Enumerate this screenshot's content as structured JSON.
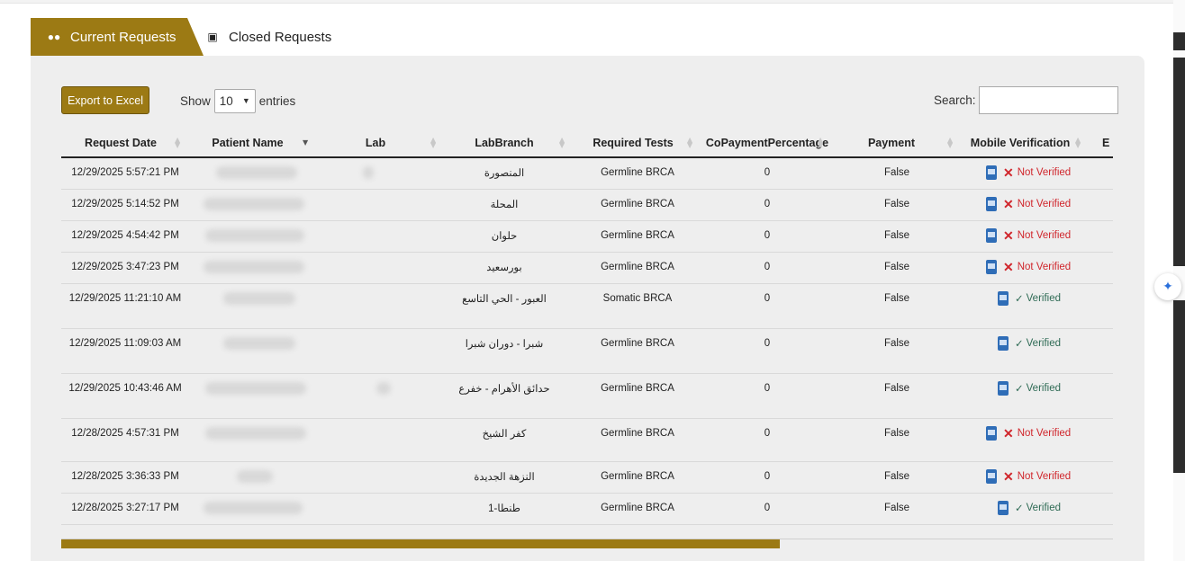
{
  "tabs": [
    {
      "label": "Current Requests",
      "icon": "users-icon",
      "active": true
    },
    {
      "label": "Closed Requests",
      "icon": "ticket-icon",
      "active": false
    }
  ],
  "toolbar": {
    "export_label": "Export to Excel",
    "show_label": "Show",
    "entries_value": "10",
    "entries_label": "entries",
    "search_label": "Search:",
    "search_value": ""
  },
  "table": {
    "columns": [
      "Request Date",
      "Patient Name",
      "Lab",
      "LabBranch",
      "Required Tests",
      "CoPaymentPercentage",
      "Payment",
      "Mobile Verification",
      "E"
    ],
    "rows": [
      {
        "date": "12/29/2025 5:57:21 PM",
        "branch": "المنصورة",
        "test": "Germline BRCA",
        "copay": "0",
        "payment": "False",
        "verified": "Not Verified"
      },
      {
        "date": "12/29/2025 5:14:52 PM",
        "branch": "المحلة",
        "test": "Germline BRCA",
        "copay": "0",
        "payment": "False",
        "verified": "Not Verified"
      },
      {
        "date": "12/29/2025 4:54:42 PM",
        "branch": "حلوان",
        "test": "Germline BRCA",
        "copay": "0",
        "payment": "False",
        "verified": "Not Verified"
      },
      {
        "date": "12/29/2025 3:47:23 PM",
        "branch": "بورسعيد",
        "test": "Germline BRCA",
        "copay": "0",
        "payment": "False",
        "verified": "Not Verified"
      },
      {
        "date": "12/29/2025 11:21:10 AM",
        "branch": "العبور - الحي التاسع",
        "test": "Somatic BRCA",
        "copay": "0",
        "payment": "False",
        "verified": "Verified"
      },
      {
        "date": "12/29/2025 11:09:03 AM",
        "branch": "شبرا - دوران شبرا",
        "test": "Germline BRCA",
        "copay": "0",
        "payment": "False",
        "verified": "Verified"
      },
      {
        "date": "12/29/2025 10:43:46 AM",
        "branch": "حدائق الأهرام - خفرع",
        "test": "Germline BRCA",
        "copay": "0",
        "payment": "False",
        "verified": "Verified"
      },
      {
        "date": "12/28/2025 4:57:31 PM",
        "branch": "كفر الشيخ",
        "test": "Germline BRCA",
        "copay": "0",
        "payment": "False",
        "verified": "Not Verified"
      },
      {
        "date": "12/28/2025 3:36:33 PM",
        "branch": "النزهة الجديدة",
        "test": "Germline BRCA",
        "copay": "0",
        "payment": "False",
        "verified": "Not Verified"
      },
      {
        "date": "12/28/2025 3:27:17 PM",
        "branch": "طنطا-1",
        "test": "Germline BRCA",
        "copay": "0",
        "payment": "False",
        "verified": "Verified"
      }
    ]
  },
  "colors": {
    "accent": "#9c7a14",
    "not_verified": "#d0262c",
    "verified": "#2f6b55",
    "phone_icon": "#2f6db7"
  }
}
